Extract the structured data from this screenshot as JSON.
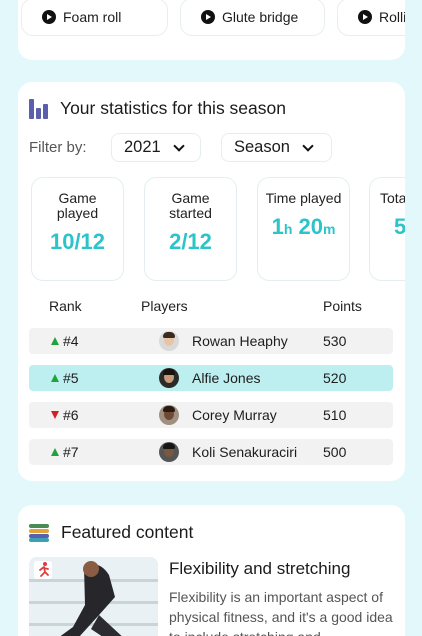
{
  "exercises": [
    {
      "label": "Foam roll",
      "icon": "play-icon"
    },
    {
      "label": "Glute bridge",
      "icon": "play-icon"
    },
    {
      "label": "Rolling",
      "icon": "play-icon"
    }
  ],
  "stats": {
    "title": "Your statistics for this season",
    "title_icon": "bar-chart-icon",
    "filter_label": "Filter by:",
    "year_select": "2021",
    "period_select": "Season",
    "boxes": [
      {
        "label": "Game played",
        "value": "10/12"
      },
      {
        "label": "Game started",
        "value": "2/12"
      },
      {
        "label": "Time played",
        "value_h": "1",
        "unit_h": "h",
        "value_m": "20",
        "unit_m": "m"
      },
      {
        "label": "Total score",
        "value": "5"
      }
    ],
    "columns": {
      "rank": "Rank",
      "players": "Players",
      "points": "Points"
    },
    "rows": [
      {
        "trend": "up",
        "rank": "#4",
        "player": "Rowan Heaphy",
        "points": "530",
        "highlight": false
      },
      {
        "trend": "up",
        "rank": "#5",
        "player": "Alfie Jones",
        "points": "520",
        "highlight": true
      },
      {
        "trend": "down",
        "rank": "#6",
        "player": "Corey Murray",
        "points": "510",
        "highlight": false
      },
      {
        "trend": "up",
        "rank": "#7",
        "player": "Koli Senakuraciri",
        "points": "500",
        "highlight": false
      }
    ],
    "colors": {
      "accent": "#2cc4c9",
      "highlight": "#bdeff1",
      "up": "#1fa33c",
      "down": "#d42020"
    }
  },
  "featured": {
    "title": "Featured content",
    "title_icon": "layers-icon",
    "article_icon": "running-person-icon",
    "heading": "Flexibility and stretching",
    "text": "Flexibility is an important aspect of physical fitness, and it's a good idea to include stretching and"
  }
}
